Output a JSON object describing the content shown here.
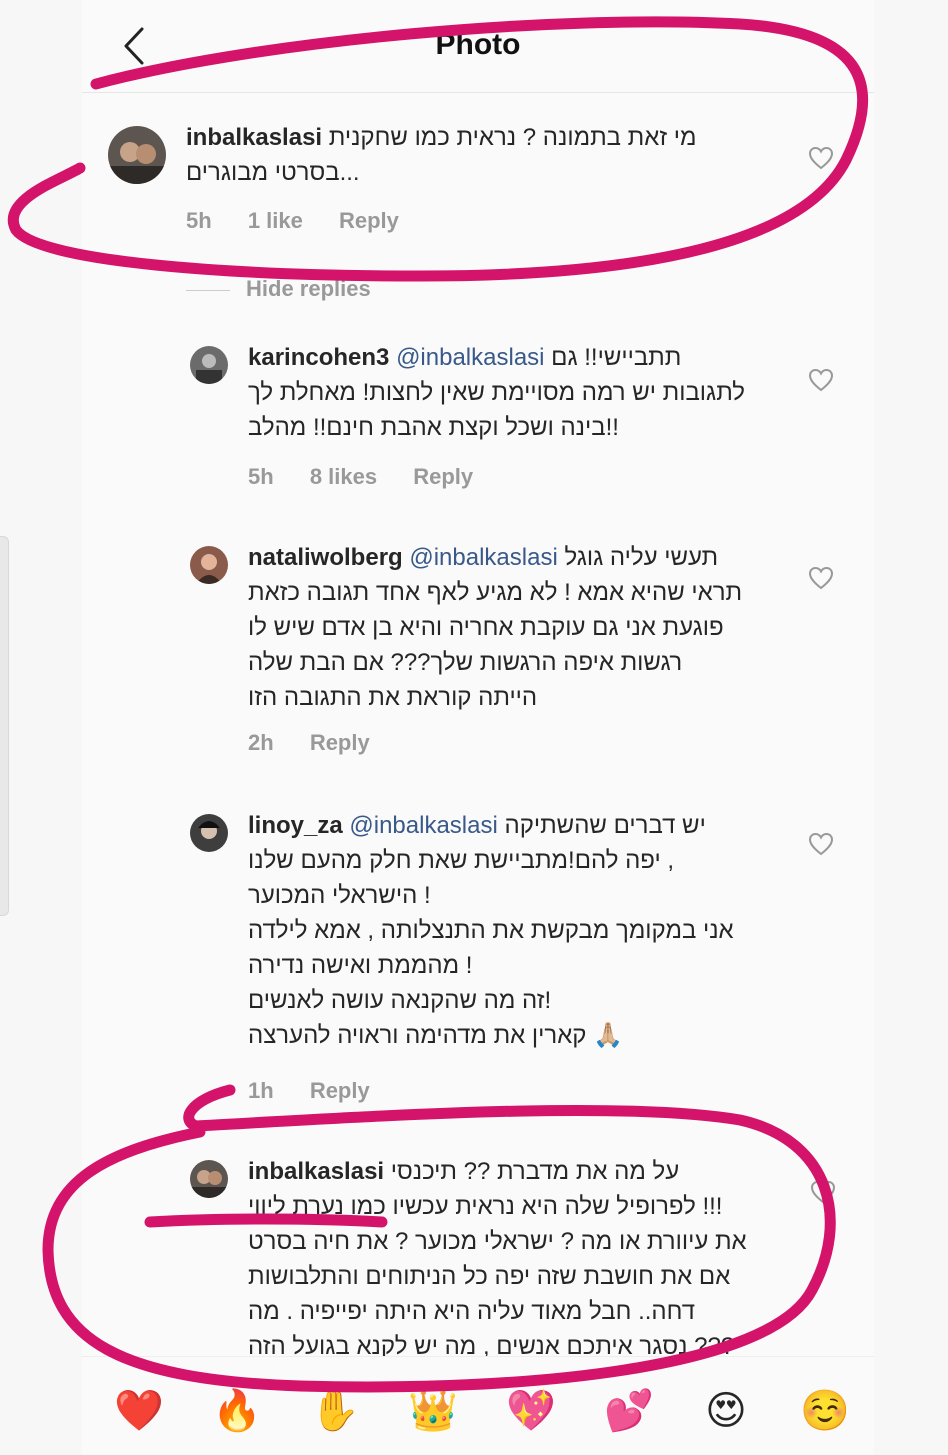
{
  "header": {
    "title": "Photo"
  },
  "comments": [
    {
      "username": "inbalkaslasi",
      "mention": "",
      "lines": [
        "מי זאת בתמונה ? נראית כמו שחקנית",
        "בסרטי מבוגרים..."
      ],
      "time": "5h",
      "likes": "1 like",
      "reply": "Reply"
    },
    {
      "username": "karincohen3",
      "mention": "@inbalkaslasi",
      "lines": [
        "תתביישי!! גם",
        "לתגובות יש רמה מסויימת שאין לחצות! מאחלת לך",
        "בינה ושכל וקצת אהבת חינם!! מהלב!!"
      ],
      "time": "5h",
      "likes": "8 likes",
      "reply": "Reply"
    },
    {
      "username": "nataliwolberg",
      "mention": "@inbalkaslasi",
      "lines": [
        "תעשי עליה גוגל",
        "תראי שהיא אמא ! לא מגיע לאף אחד תגובה כזאת",
        "פוגעת אני גם עוקבת אחריה והיא בן אדם שיש לו",
        "רגשות איפה הרגשות שלך??? אם הבת שלה",
        "הייתה קוראת את התגובה הזו"
      ],
      "time": "2h",
      "likes": "",
      "reply": "Reply"
    },
    {
      "username": "linoy_za",
      "mention": "@inbalkaslasi",
      "lines": [
        "יש דברים שהשתיקה",
        "יפה להם!מתביישת שאת חלק מהעם שלנו ,",
        "הישראלי המכוער !",
        "אני במקומך מבקשת את התנצלותה , אמא לילדה",
        "מהממת ואישה נדירה !",
        "זה מה שהקנאה עושה לאנשים!",
        "קארין את מדהימה וראויה להערצה 🙏🏼"
      ],
      "time": "1h",
      "likes": "",
      "reply": "Reply"
    },
    {
      "username": "inbalkaslasi",
      "mention": "",
      "lines": [
        "על מה את מדברת ?? תיכנסי",
        "לפרופיל שלה היא נראית עכשיו כמו נערת ליווי !!!",
        "את עיוורת או מה ? ישראלי מכוער ? את חיה בסרט",
        "אם את חושבת שזה יפה כל הניתוחים והתלבושות",
        "דחה.. חבל מאוד עליה היא היתה יפייפיה . מה",
        "נסגר איתכם אנשים , מה יש לקנא בגועל הזה ???"
      ],
      "time": "",
      "likes": "",
      "reply": ""
    }
  ],
  "hide_replies": "Hide replies",
  "emoji_bar": [
    "❤️",
    "🔥",
    "✋",
    "👑",
    "💖",
    "💕",
    "😍",
    "☺️"
  ],
  "icons": {
    "back": "chevron-left-icon",
    "like": "heart-outline-icon"
  },
  "colors": {
    "marker": "#d4146b",
    "mention": "#38598a",
    "meta": "#999999"
  }
}
